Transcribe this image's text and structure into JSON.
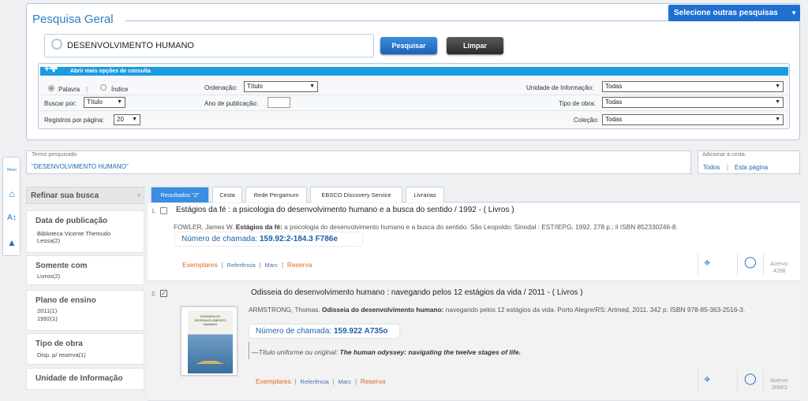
{
  "leftbar": {
    "icons": [
      "new-icon",
      "home-icon",
      "text-size-icon",
      "up-arrow-icon"
    ],
    "first_label": "Novo"
  },
  "search": {
    "panel_title": "Pesquisa Geral",
    "other_searches": "Selecione outras pesquisas",
    "query": "DESENVOLVIMENTO HUMANO",
    "search_button": "Pesquisar",
    "clear_button": "Limpar"
  },
  "options": {
    "header": "Abrir mais opções de consulta",
    "radio_word": "Palavra",
    "radio_sep": "|",
    "radio_index": "Índice",
    "search_by_label": "Buscar por:",
    "search_by_value": "Título",
    "per_page_label": "Registros por página:",
    "per_page_value": "20",
    "order_label": "Ordenação:",
    "order_value": "Título",
    "year_label": "Ano de publicação:",
    "year_value": "",
    "unit_label": "Unidade de Informação:",
    "unit_value": "Todas",
    "work_type_label": "Tipo de obra:",
    "work_type_value": "Todas",
    "collection_label": "Coleção:",
    "collection_value": "Todas"
  },
  "term": {
    "caption": "Termo pesquisado",
    "value": "\"DESENVOLVIMENTO HUMANO\""
  },
  "cart": {
    "caption": "Adicionar à cesta:",
    "all": "Todos",
    "sep": "|",
    "page": "Esta página"
  },
  "refine": {
    "header": "Refinar sua busca",
    "collapse": "«",
    "facets": [
      {
        "title": "Data de publicação",
        "items": [
          "Biblioteca Vicente Themudo",
          "Lessa(2)"
        ]
      },
      {
        "title": "Somente com",
        "items": [
          "Livros(2)"
        ]
      },
      {
        "title": "Plano de ensino",
        "items": [
          "2011(1)",
          "1992(1)"
        ]
      },
      {
        "title": "Tipo de obra",
        "items": [
          "Disp. p/ reserva(1)"
        ]
      },
      {
        "title": "Unidade de Informação",
        "items": []
      }
    ]
  },
  "tabs": [
    "Resultados \"2\"",
    "Cesta",
    "Rede Pergamum",
    "EBSCO Discovery Service",
    "Livrarias"
  ],
  "results": [
    {
      "num": "1.",
      "checked": false,
      "title": "Estágios da fé : a psicologia do desenvolvimento humano e a busca do sentido / 1992 -  ( Livros )",
      "author": "FOWLER, James W.",
      "bold_title": "Estágios da fé:",
      "rest": " a psicologia do desenvolvimento humano e a busca do sentido. São Leopoldo: Sinodal : EST/IEPG, 1992. 278 p.; il ISBN 852330246-8.",
      "call_label": "Número de chamada:",
      "call_value": "159.92:2-184.3 F786e",
      "links": [
        "Exemplares",
        "Referência",
        "Marc",
        "Reserva"
      ],
      "acervo_label": "Acervo:",
      "acervo_value": "4298"
    },
    {
      "num": "2.",
      "checked": true,
      "title": "Odisseia do desenvolvimento humano : navegando pelos 12 estágios da vida / 2011 -  ( Livros )",
      "author": "ARMSTRONG, Thomas.",
      "bold_title": "Odisseia do desenvolvimento humano:",
      "rest": " navegando pelos 12 estágios da vida. Porto Alegre/RS: Artmed, 2011. 342 p. ISBN 978-85-363-2516-3.",
      "call_label": "Número de chamada:",
      "call_value": "159.922 A735o",
      "uniform_label": "Título uniforme ou original:",
      "uniform_value": "The human odyssey: navigating the twelve stages of life.",
      "cover_title": "ODISSEIA DO DESENVOLVIMENTO HUMANO",
      "links": [
        "Exemplares",
        "Referência",
        "Marc",
        "Reserva"
      ],
      "acervo_label": "Acervo:",
      "acervo_value": "20663"
    }
  ],
  "colors": {
    "accent": "#2d7ec4",
    "button_blue": "#1f6fd1",
    "link_orange": "#e06a20"
  }
}
